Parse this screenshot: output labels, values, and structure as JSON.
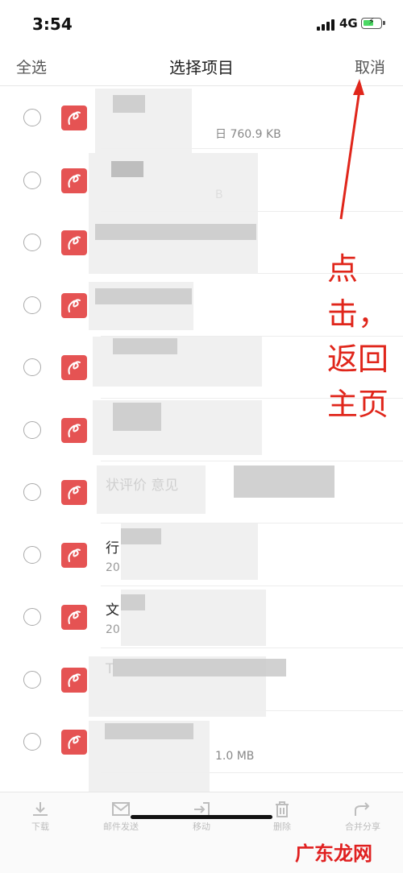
{
  "status_bar": {
    "time": "3:54",
    "network": "4G"
  },
  "nav": {
    "select_all": "全选",
    "title": "选择项目",
    "cancel": "取消"
  },
  "files": [
    {
      "name": "",
      "meta": "日  760.9 KB"
    },
    {
      "name": "",
      "meta": "B"
    },
    {
      "name": "",
      "meta": ""
    },
    {
      "name": "",
      "meta": ""
    },
    {
      "name": "",
      "meta": ""
    },
    {
      "name": "",
      "meta": ""
    },
    {
      "name": "状评价 意见",
      "meta": ""
    },
    {
      "name": "行",
      "meta": "20"
    },
    {
      "name": "文",
      "meta": "20"
    },
    {
      "name": "T",
      "meta": ""
    },
    {
      "name": "",
      "meta": "1.0 MB"
    }
  ],
  "annotation": {
    "line1": "点",
    "line2": "击，",
    "line3": "返回",
    "line4": "主页",
    "color": "#e0261b"
  },
  "toolbar": {
    "download": "下载",
    "email": "邮件发送",
    "move": "移动",
    "delete": "删除",
    "merge_share": "合并分享"
  },
  "watermark": "广东龙网",
  "colors": {
    "pdf_icon": "#e55353",
    "annotation": "#e0261b"
  }
}
